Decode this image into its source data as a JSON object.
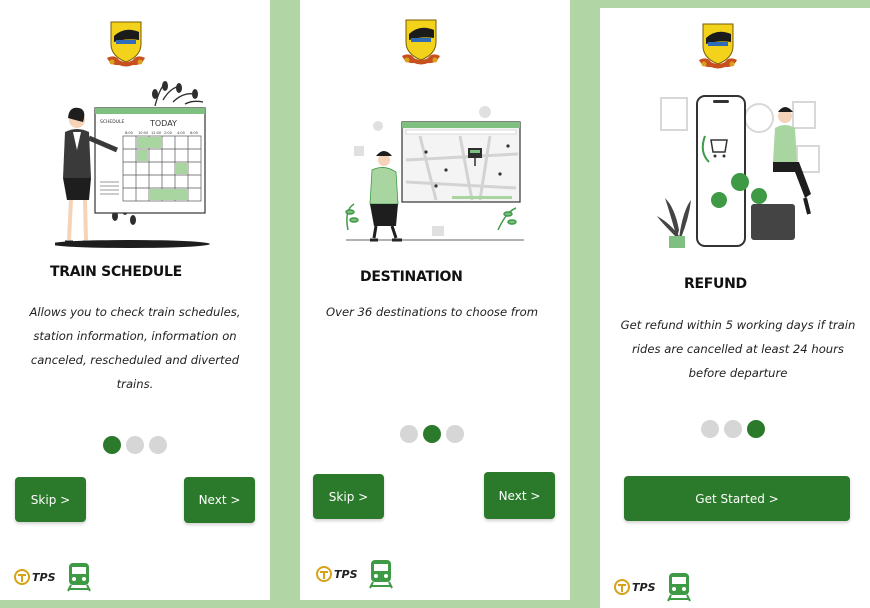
{
  "colors": {
    "primary_green": "#2b7a2b",
    "light_green": "#a8d5a0",
    "dot_inactive": "#d6d6d6",
    "background": "#b2d5a6"
  },
  "icons": {
    "logo": "railway-crest-logo",
    "tps": "tps-logo",
    "train": "train-icon"
  },
  "screens": [
    {
      "title": "TRAIN SCHEDULE",
      "description": "Allows you to check train schedules, station information, information on canceled, rescheduled and diverted trains.",
      "active_dot": 1,
      "skip_label": "Skip  >",
      "next_label": "Next  >",
      "illustration": {
        "schedule_label": "SCHEDULE",
        "today_label": "TODAY",
        "times": [
          "8:00",
          "10:00",
          "12:00",
          "2:00",
          "4:00",
          "6:00"
        ]
      }
    },
    {
      "title": "DESTINATION",
      "description": "Over 36 destinations to choose from",
      "active_dot": 2,
      "skip_label": "Skip  >",
      "next_label": "Next  >"
    },
    {
      "title": "REFUND",
      "description": "Get refund within 5 working days if train rides are cancelled at least 24 hours before departure",
      "active_dot": 3,
      "cta_label": "Get Started >"
    }
  ],
  "footer": {
    "tps_label": "TPS"
  }
}
